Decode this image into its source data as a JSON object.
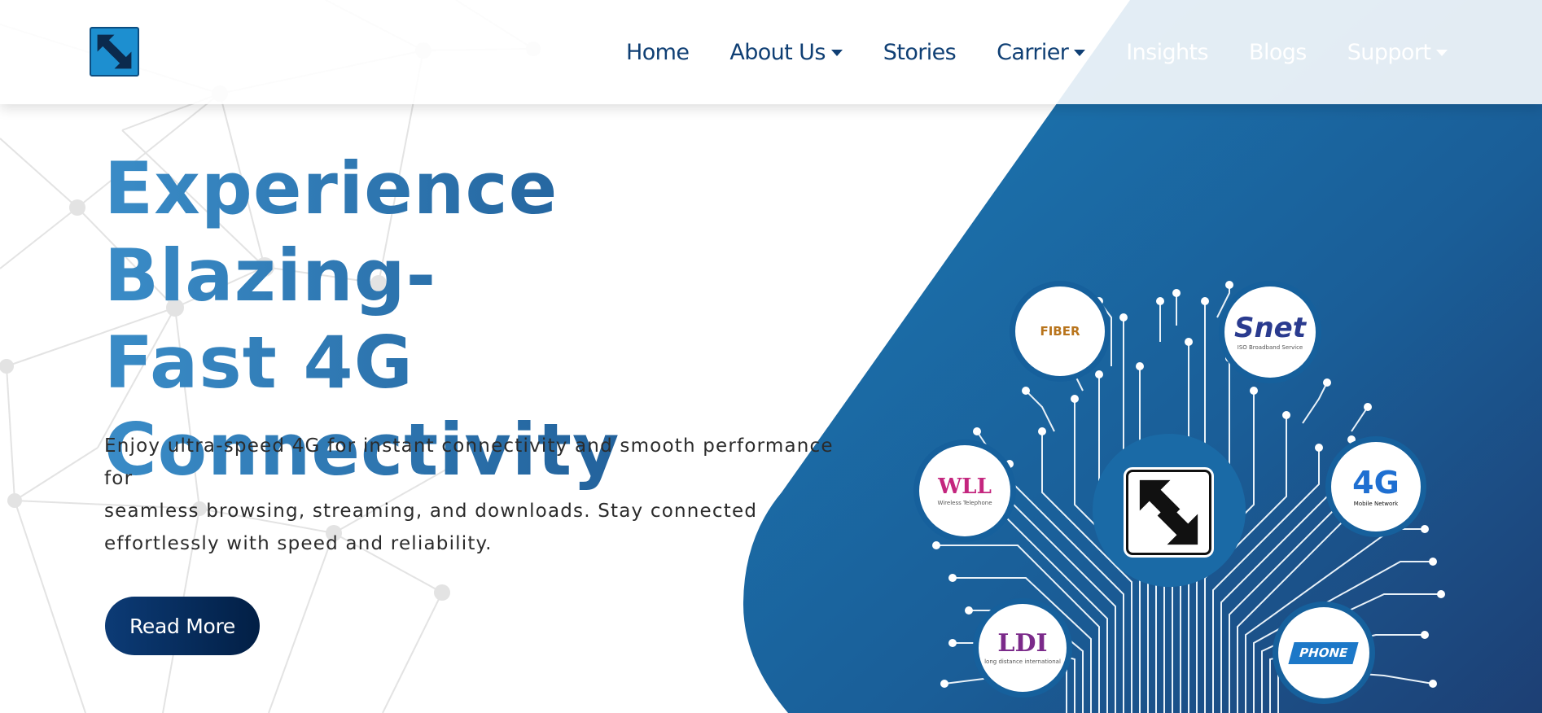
{
  "brand": {
    "logo_icon": "arrows-diagonal-icon"
  },
  "nav": {
    "items": [
      {
        "label": "Home",
        "dropdown": false
      },
      {
        "label": "About Us",
        "dropdown": true
      },
      {
        "label": "Stories",
        "dropdown": false
      },
      {
        "label": "Carrier",
        "dropdown": true
      },
      {
        "label": "Insights",
        "dropdown": false
      },
      {
        "label": "Blogs",
        "dropdown": false
      },
      {
        "label": "Support",
        "dropdown": true
      }
    ]
  },
  "hero": {
    "title_lines": [
      "Experience Blazing-",
      "Fast 4G",
      "Connectivity"
    ],
    "description_lines": [
      "Enjoy ultra-speed 4G for instant connectivity and smooth performance",
      "for",
      "seamless browsing, streaming, and downloads. Stay connected",
      "effortlessly with speed and reliability."
    ],
    "cta_label": "Read More"
  },
  "services": {
    "fiber": {
      "label": "FIBER"
    },
    "snet": {
      "label": "Snet",
      "sub": "ISO Broadband Service"
    },
    "wll": {
      "label": "WLL",
      "sub": "Wireless Telephone"
    },
    "g4": {
      "label": "4G",
      "sub": "Mobile Network"
    },
    "ldi": {
      "label": "LDI",
      "sub": "long distance international"
    },
    "phone": {
      "label": "PHONE"
    }
  },
  "colors": {
    "panel_start": "#1c77b2",
    "panel_end": "#1d3f74",
    "nav_text": "#0f3f74",
    "cta_bg": "#0c3b76"
  }
}
